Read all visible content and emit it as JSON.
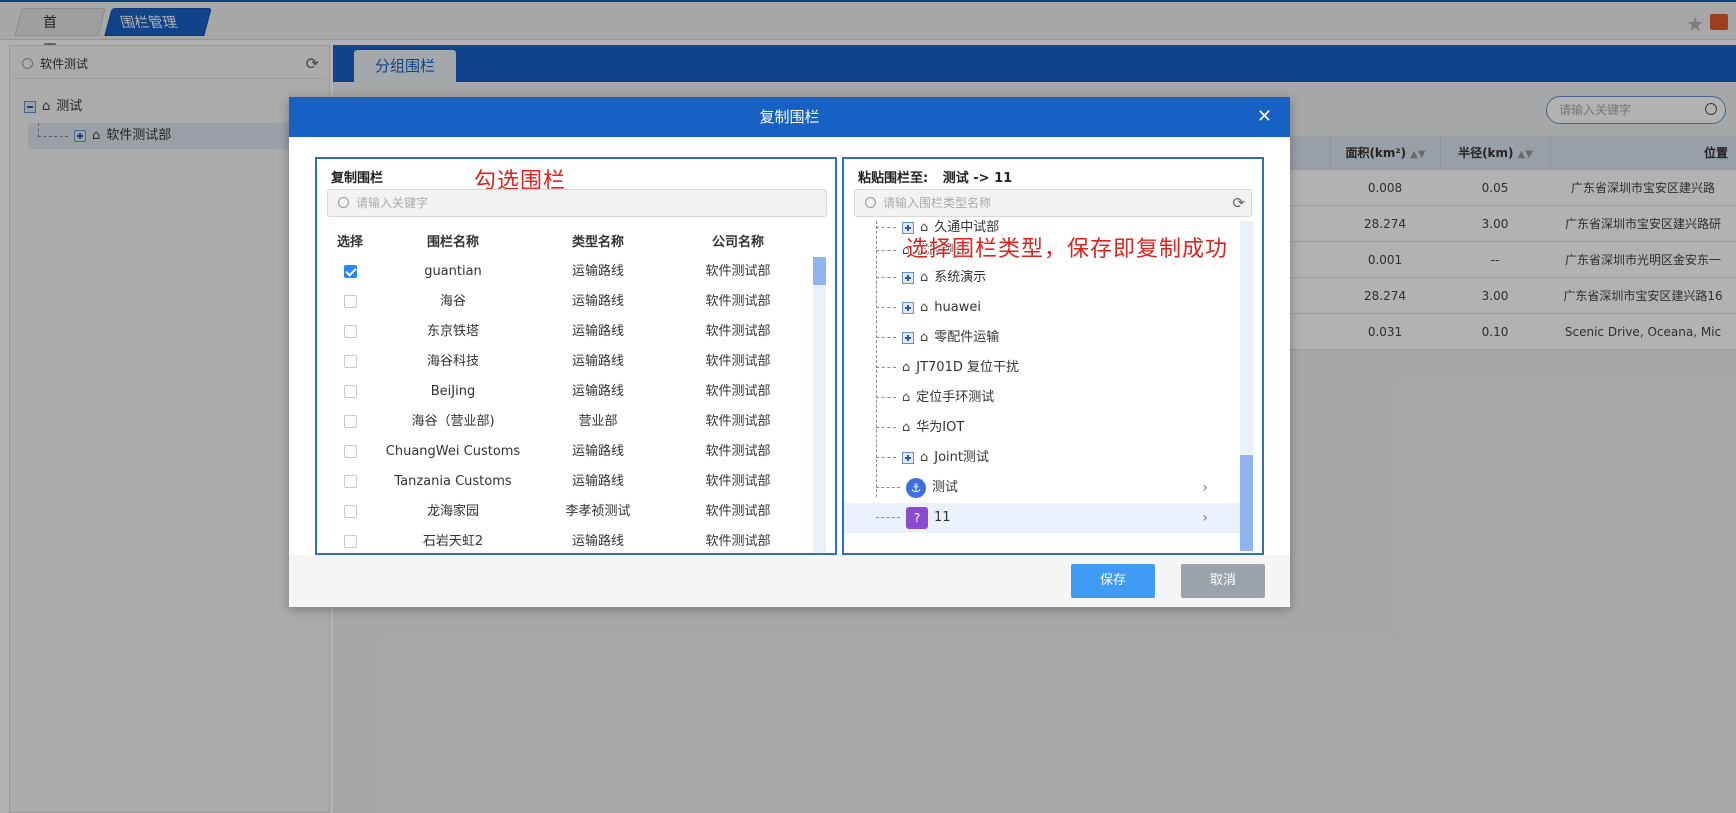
{
  "tabs": {
    "home": "首页",
    "fence_mgmt": "围栏管理",
    "close": "✕"
  },
  "left_panel": {
    "search_value": "软件测试",
    "tree": [
      {
        "label": "测试"
      },
      {
        "label": "软件测试部"
      }
    ]
  },
  "main": {
    "tab": "分组围栏",
    "search_placeholder": "请输入关键字",
    "columns": {
      "area": "面积(km²)",
      "radius": "半径(km)",
      "location": "位置"
    },
    "rows": [
      {
        "area": "0.008",
        "radius": "0.05",
        "location": "广东省深圳市宝安区建兴路"
      },
      {
        "area": "28.274",
        "radius": "3.00",
        "location": "广东省深圳市宝安区建兴路研"
      },
      {
        "area": "0.001",
        "radius": "--",
        "location": "广东省深圳市光明区金安东一"
      },
      {
        "area": "28.274",
        "radius": "3.00",
        "location": "广东省深圳市宝安区建兴路16"
      },
      {
        "area": "0.031",
        "radius": "0.10",
        "location": "Scenic Drive, Oceana, Mic"
      }
    ]
  },
  "dialog": {
    "title": "复制围栏",
    "close": "✕",
    "left": {
      "label": "复制围栏",
      "annotation": "勾选围栏",
      "search_placeholder": "请输入关键字",
      "headers": {
        "select": "选择",
        "name": "围栏名称",
        "type": "类型名称",
        "company": "公司名称"
      },
      "rows": [
        {
          "name": "guantian",
          "type": "运输路线",
          "company": "软件测试部",
          "checked": true
        },
        {
          "name": "海谷",
          "type": "运输路线",
          "company": "软件测试部",
          "checked": false
        },
        {
          "name": "东京铁塔",
          "type": "运输路线",
          "company": "软件测试部",
          "checked": false
        },
        {
          "name": "海谷科技",
          "type": "运输路线",
          "company": "软件测试部",
          "checked": false
        },
        {
          "name": "BeiJing",
          "type": "运输路线",
          "company": "软件测试部",
          "checked": false
        },
        {
          "name": "海谷（营业部)",
          "type": "营业部",
          "company": "软件测试部",
          "checked": false
        },
        {
          "name": "ChuangWei Customs",
          "type": "运输路线",
          "company": "软件测试部",
          "checked": false
        },
        {
          "name": "Tanzania Customs",
          "type": "运输路线",
          "company": "软件测试部",
          "checked": false
        },
        {
          "name": "龙海家园",
          "type": "李孝祯测试",
          "company": "软件测试部",
          "checked": false
        },
        {
          "name": "石岩天虹2",
          "type": "运输路线",
          "company": "软件测试部",
          "checked": false
        }
      ]
    },
    "right": {
      "label": "粘贴围栏至:",
      "target": "测试 -> 11",
      "annotation": "选择围栏类型，保存即复制成功",
      "search_placeholder": "请输入围栏类型名称",
      "tree": [
        {
          "label": "久通中试部",
          "kind": "group"
        },
        {
          "label": "优能测试",
          "kind": "leaf"
        },
        {
          "label": "系统演示",
          "kind": "group"
        },
        {
          "label": "huawei",
          "kind": "group"
        },
        {
          "label": "零配件运输",
          "kind": "group"
        },
        {
          "label": "JT701D 复位干扰",
          "kind": "leaf"
        },
        {
          "label": "定位手环测试",
          "kind": "leaf"
        },
        {
          "label": "华为IOT",
          "kind": "leaf"
        },
        {
          "label": "Joint测试",
          "kind": "group"
        },
        {
          "label": "测试",
          "kind": "type-anchor"
        },
        {
          "label": "11",
          "kind": "type-question"
        }
      ]
    },
    "buttons": {
      "save": "保存",
      "cancel": "取消"
    }
  },
  "colors": {
    "brand": "#1761c4",
    "annotation": "#e0221c",
    "save": "#3f9bf4",
    "cancel": "#9aa3ac"
  }
}
